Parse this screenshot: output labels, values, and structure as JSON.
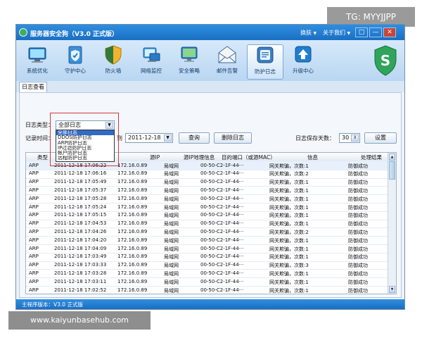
{
  "window": {
    "title": "服务器安全狗（V3.0 正式版）",
    "menus": [
      "换肤",
      "关于我们"
    ],
    "controls": [
      "□",
      "—",
      "✕"
    ]
  },
  "toolbar": {
    "items": [
      {
        "label": "系统优化",
        "icon": "computer-optimize-icon"
      },
      {
        "label": "守护中心",
        "icon": "shield-center-icon"
      },
      {
        "label": "防火墙",
        "icon": "firewall-shield-icon"
      },
      {
        "label": "网络监控",
        "icon": "network-monitor-icon"
      },
      {
        "label": "安全策略",
        "icon": "security-policy-icon"
      },
      {
        "label": "邮件告警",
        "icon": "mail-alert-icon"
      },
      {
        "label": "防护日志",
        "icon": "protection-log-icon",
        "active": true
      },
      {
        "label": "升级中心",
        "icon": "upgrade-icon"
      }
    ],
    "brand_letter": "S"
  },
  "tabs": [
    "日志查看"
  ],
  "filters": {
    "log_type_label": "日志类型：",
    "log_type_value": "全部日志",
    "record_time_label": "记录时间：",
    "to_label": "到",
    "end_date": "2011-12-18",
    "query_button": "查询",
    "delete_button": "删除日志",
    "retention_label": "日志保存天数：",
    "retention_days": "30",
    "settings_button": "设置"
  },
  "dropdown_options": [
    "全部日志",
    "DDOS防护日志",
    "ARP防护日志",
    "IP过滤防护日志",
    "帐户防护日志",
    "远程防护日志"
  ],
  "table": {
    "columns": [
      "类型",
      "",
      "源IP",
      "源IP地理信息",
      "目的端口（或源MAC）",
      "信息",
      "处理结果"
    ],
    "rows": [
      {
        "type": "ARP",
        "time": "2011-12-18 17:06:22",
        "ip": "172.16.0.89",
        "geo": "局域网",
        "port": "00-50-C2-1F-44···",
        "info": "网关欺骗，次数:1",
        "result": "防御成功"
      },
      {
        "type": "ARP",
        "time": "2011-12-18 17:06:16",
        "ip": "172.16.0.89",
        "geo": "局域网",
        "port": "00-50-C2-1F-44···",
        "info": "网关欺骗，次数:2",
        "result": "防御成功"
      },
      {
        "type": "ARP",
        "time": "2011-12-18 17:05:49",
        "ip": "172.16.0.89",
        "geo": "局域网",
        "port": "00-50-C2-1F-44···",
        "info": "网关欺骗，次数:1",
        "result": "防御成功"
      },
      {
        "type": "ARP",
        "time": "2011-12-18 17:05:37",
        "ip": "172.16.0.89",
        "geo": "局域网",
        "port": "00-50-C2-1F-44···",
        "info": "网关欺骗，次数:1",
        "result": "防御成功"
      },
      {
        "type": "ARP",
        "time": "2011-12-18 17:05:28",
        "ip": "172.16.0.89",
        "geo": "局域网",
        "port": "00-50-C2-1F-44···",
        "info": "网关欺骗，次数:1",
        "result": "防御成功"
      },
      {
        "type": "ARP",
        "time": "2011-12-18 17:05:24",
        "ip": "172.16.0.89",
        "geo": "局域网",
        "port": "00-50-C2-1F-44···",
        "info": "网关欺骗，次数:1",
        "result": "防御成功"
      },
      {
        "type": "ARP",
        "time": "2011-12-18 17:05:15",
        "ip": "172.16.0.89",
        "geo": "局域网",
        "port": "00-50-C2-1F-44···",
        "info": "网关欺骗，次数:1",
        "result": "防御成功"
      },
      {
        "type": "ARP",
        "time": "2011-12-18 17:04:53",
        "ip": "172.16.0.89",
        "geo": "局域网",
        "port": "00-50-C2-1F-44···",
        "info": "网关欺骗，次数:1",
        "result": "防御成功"
      },
      {
        "type": "ARP",
        "time": "2011-12-18 17:04:26",
        "ip": "172.16.0.89",
        "geo": "局域网",
        "port": "00-50-C2-1F-44···",
        "info": "网关欺骗，次数:2",
        "result": "防御成功"
      },
      {
        "type": "ARP",
        "time": "2011-12-18 17:04:20",
        "ip": "172.16.0.89",
        "geo": "局域网",
        "port": "00-50-C2-1F-44···",
        "info": "网关欺骗，次数:1",
        "result": "防御成功"
      },
      {
        "type": "ARP",
        "time": "2011-12-18 17:04:09",
        "ip": "172.16.0.89",
        "geo": "局域网",
        "port": "00-50-C2-1F-44···",
        "info": "网关欺骗，次数:1",
        "result": "防御成功"
      },
      {
        "type": "ARP",
        "time": "2011-12-18 17:03:49",
        "ip": "172.16.0.89",
        "geo": "局域网",
        "port": "00-50-C2-1F-44···",
        "info": "网关欺骗，次数:1",
        "result": "防御成功"
      },
      {
        "type": "ARP",
        "time": "2011-12-18 17:03:33",
        "ip": "172.16.0.89",
        "geo": "局域网",
        "port": "00-50-C2-1F-44···",
        "info": "网关欺骗，次数:3",
        "result": "防御成功"
      },
      {
        "type": "ARP",
        "time": "2011-12-18 17:03:28",
        "ip": "172.16.0.89",
        "geo": "局域网",
        "port": "00-50-C2-1F-44···",
        "info": "网关欺骗，次数:1",
        "result": "防御成功"
      },
      {
        "type": "ARP",
        "time": "2011-12-18 17:03:11",
        "ip": "172.16.0.89",
        "geo": "局域网",
        "port": "00-50-C2-1F-44···",
        "info": "网关欺骗，次数:1",
        "result": "防御成功"
      },
      {
        "type": "ARP",
        "time": "2011-12-18 17:02:52",
        "ip": "172.16.0.89",
        "geo": "局域网",
        "port": "00-50-C2-1F-44···",
        "info": "网关欺骗，次数:1",
        "result": "防御成功"
      }
    ]
  },
  "statusbar": {
    "version": "主程序版本：V3.0 正式版"
  },
  "watermarks": {
    "top": "TG: MYYJJPP",
    "bottom": "www.kaiyunbasehub.com"
  },
  "colors": {
    "titlebar": "#1f7fd4",
    "selection": "#316ac5",
    "highlight_box": "#d23b3b"
  }
}
